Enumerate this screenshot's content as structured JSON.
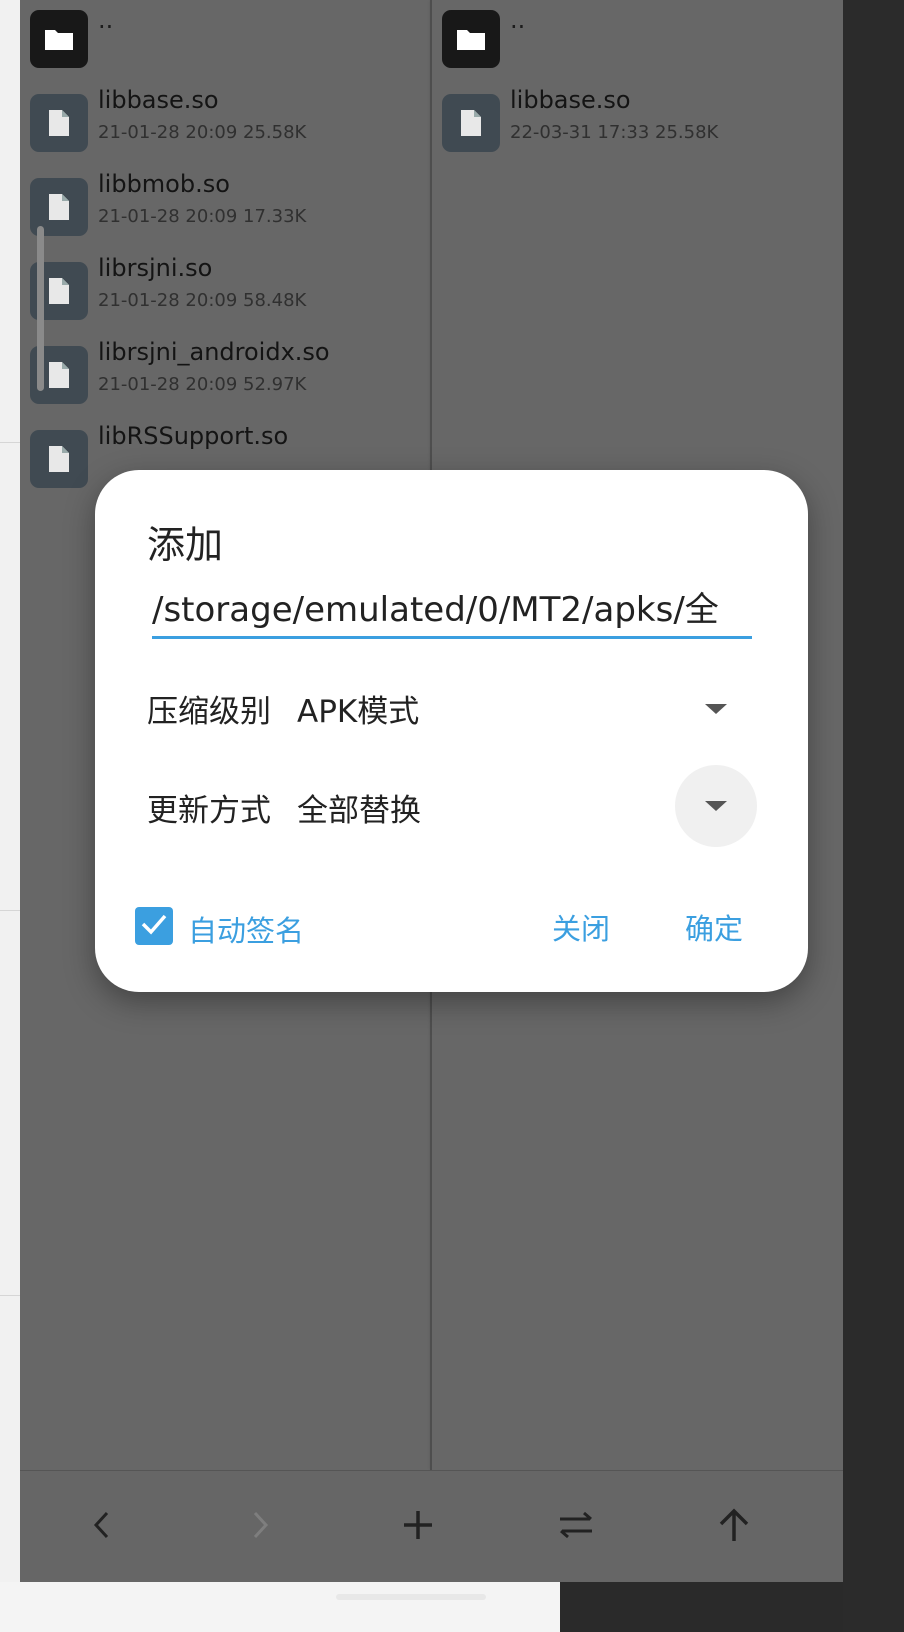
{
  "left_pane": {
    "parent_label": "..",
    "files": [
      {
        "name": "libbase.so",
        "meta": "21-01-28 20:09  25.58K"
      },
      {
        "name": "libbmob.so",
        "meta": "21-01-28 20:09  17.33K"
      },
      {
        "name": "librsjni.so",
        "meta": "21-01-28 20:09  58.48K"
      },
      {
        "name": "librsjni_androidx.so",
        "meta": "21-01-28 20:09  52.97K"
      },
      {
        "name": "libRSSupport.so",
        "meta": ""
      }
    ]
  },
  "right_pane": {
    "parent_label": "..",
    "files": [
      {
        "name": "libbase.so",
        "meta": "22-03-31 17:33  25.58K"
      }
    ]
  },
  "dialog": {
    "title": "添加",
    "path_value": "/storage/emulated/0/MT2/apks/全",
    "compression": {
      "label": "压缩级别",
      "value": "APK模式"
    },
    "update_mode": {
      "label": "更新方式",
      "value": "全部替换"
    },
    "auto_sign": {
      "label": "自动签名",
      "checked": true
    },
    "close_label": "关闭",
    "confirm_label": "确定"
  },
  "toolbar": {
    "back_icon": "chevron-left-icon",
    "forward_icon": "chevron-right-icon",
    "add_icon": "plus-icon",
    "swap_icon": "swap-icon",
    "up_icon": "arrow-up-icon"
  },
  "colors": {
    "accent": "#3b9fe0",
    "scrim": "#676767",
    "dialog_bg": "#ffffff"
  }
}
